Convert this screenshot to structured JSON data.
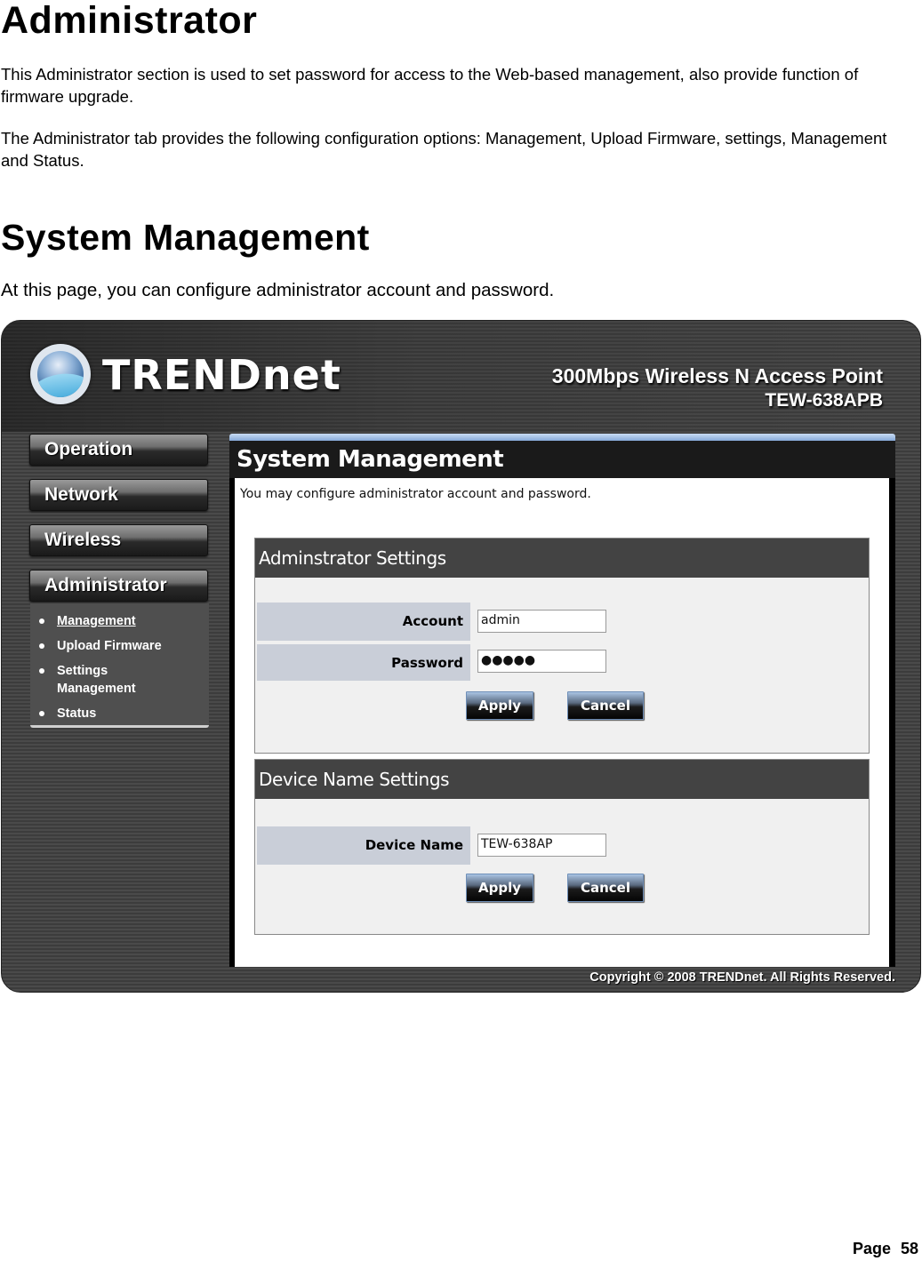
{
  "document": {
    "heading": "Administrator",
    "paragraph1": "This Administrator section is used to set password for access to the Web-based management, also provide function of firmware upgrade.",
    "paragraph2": "The Administrator tab provides the following configuration options: Management, Upload Firmware, settings, Management and Status.",
    "subheading": "System Management",
    "paragraph3": "At this page, you can configure administrator account and password.",
    "page_label": "Page 58"
  },
  "screenshot": {
    "brand": "TRENDnet",
    "logo_icon": "trendnet-globe-logo",
    "product_line1": "300Mbps Wireless N Access Point",
    "product_line2": "TEW-638APB",
    "nav": {
      "items": [
        {
          "label": "Operation"
        },
        {
          "label": "Network"
        },
        {
          "label": "Wireless"
        },
        {
          "label": "Administrator"
        }
      ],
      "submenu": [
        {
          "label": "Management",
          "active": true
        },
        {
          "label": "Upload Firmware"
        },
        {
          "label": "Settings Management"
        },
        {
          "label": "Status"
        }
      ]
    },
    "panel": {
      "title": "System Management",
      "intro": "You may configure administrator account and password.",
      "admin_box": {
        "title": "Adminstrator Settings",
        "account_label": "Account",
        "account_value": "admin",
        "password_label": "Password",
        "password_value": "●●●●●",
        "apply_label": "Apply",
        "cancel_label": "Cancel"
      },
      "device_box": {
        "title": "Device Name Settings",
        "device_label": "Device Name",
        "device_value": "TEW-638AP",
        "apply_label": "Apply",
        "cancel_label": "Cancel"
      }
    },
    "copyright": "Copyright © 2008 TRENDnet. All Rights Reserved.",
    "colors": {
      "panel_accent": "#86a9d8",
      "box_header": "#434343",
      "label_bg": "#c9ced8"
    }
  }
}
